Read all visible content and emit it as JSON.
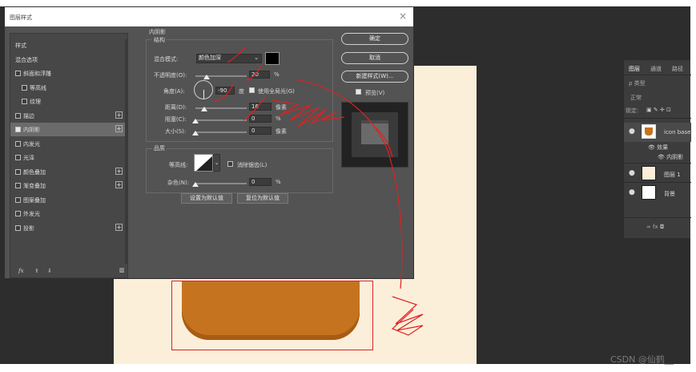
{
  "dialog": {
    "title": "图层样式",
    "close_glyph": "×",
    "left_items": [
      {
        "label": "样式",
        "checkbox": false,
        "checked": false,
        "plus": false,
        "selected": false
      },
      {
        "label": "混合选项",
        "checkbox": false,
        "checked": false,
        "plus": false,
        "selected": false
      },
      {
        "label": "斜面和浮雕",
        "checkbox": true,
        "checked": false,
        "plus": false,
        "selected": false
      },
      {
        "label": "等高线",
        "checkbox": true,
        "checked": false,
        "plus": false,
        "selected": false,
        "indent": true
      },
      {
        "label": "纹理",
        "checkbox": true,
        "checked": false,
        "plus": false,
        "selected": false,
        "indent": true
      },
      {
        "label": "描边",
        "checkbox": true,
        "checked": false,
        "plus": true,
        "selected": false
      },
      {
        "label": "内阴影",
        "checkbox": true,
        "checked": true,
        "plus": true,
        "selected": true
      },
      {
        "label": "内发光",
        "checkbox": true,
        "checked": false,
        "plus": false,
        "selected": false
      },
      {
        "label": "光泽",
        "checkbox": true,
        "checked": false,
        "plus": false,
        "selected": false
      },
      {
        "label": "颜色叠加",
        "checkbox": true,
        "checked": false,
        "plus": true,
        "selected": false
      },
      {
        "label": "渐变叠加",
        "checkbox": true,
        "checked": false,
        "plus": true,
        "selected": false
      },
      {
        "label": "图案叠加",
        "checkbox": true,
        "checked": false,
        "plus": false,
        "selected": false
      },
      {
        "label": "外发光",
        "checkbox": true,
        "checked": false,
        "plus": false,
        "selected": false
      },
      {
        "label": "投影",
        "checkbox": true,
        "checked": false,
        "plus": true,
        "selected": false
      }
    ],
    "footer_fx": "fx",
    "footer_up": "⬆",
    "footer_down": "⬇",
    "footer_trash": "🗑",
    "section_title": "内阴影",
    "structure_title": "结构",
    "blend_mode_label": "混合模式:",
    "blend_mode_value": "颜色加深",
    "opacity_label": "不透明度(O):",
    "opacity_value": "20",
    "percent": "%",
    "angle_label": "角度(A):",
    "angle_value": "-90",
    "degree": "度",
    "global_light_label": "使用全局光(G)",
    "distance_label": "距离(D):",
    "distance_value": "16",
    "px": "像素",
    "choke_label": "阻塞(C):",
    "choke_value": "0",
    "size_label": "大小(S):",
    "size_value": "0",
    "quality_title": "品质",
    "contour_label": "等高线:",
    "antialias_label": "消除锯齿(L)",
    "noise_label": "杂色(N):",
    "noise_value": "0",
    "make_default": "设置为默认值",
    "reset_default": "复位为默认值",
    "ok": "确定",
    "cancel": "取消",
    "new_style": "新建样式(W)...",
    "preview_label": "预览(V)",
    "shadow_color": "#000000"
  },
  "layers_panel": {
    "tabs": [
      "图层",
      "通道",
      "路径"
    ],
    "search_placeholder": "ρ 类型",
    "blend": "正常",
    "lock_label": "锁定:",
    "layers": [
      {
        "name": "icon base",
        "thumb_color": "#c6731f"
      },
      {
        "name": "效果",
        "sub": true
      },
      {
        "name": "内阴影",
        "sub": true
      },
      {
        "name": "图层 1",
        "thumb_color": "#fbefda"
      },
      {
        "name": "背景",
        "thumb_color": "#ffffff"
      }
    ],
    "footer_icons": "∞ fx ◘"
  },
  "watermark": "CSDN @仙鹤__",
  "colors": {
    "workspace": "#2d2d2d",
    "canvas": "#fbefda",
    "shape": "#c6731f",
    "annotation_red": "#e02020"
  }
}
